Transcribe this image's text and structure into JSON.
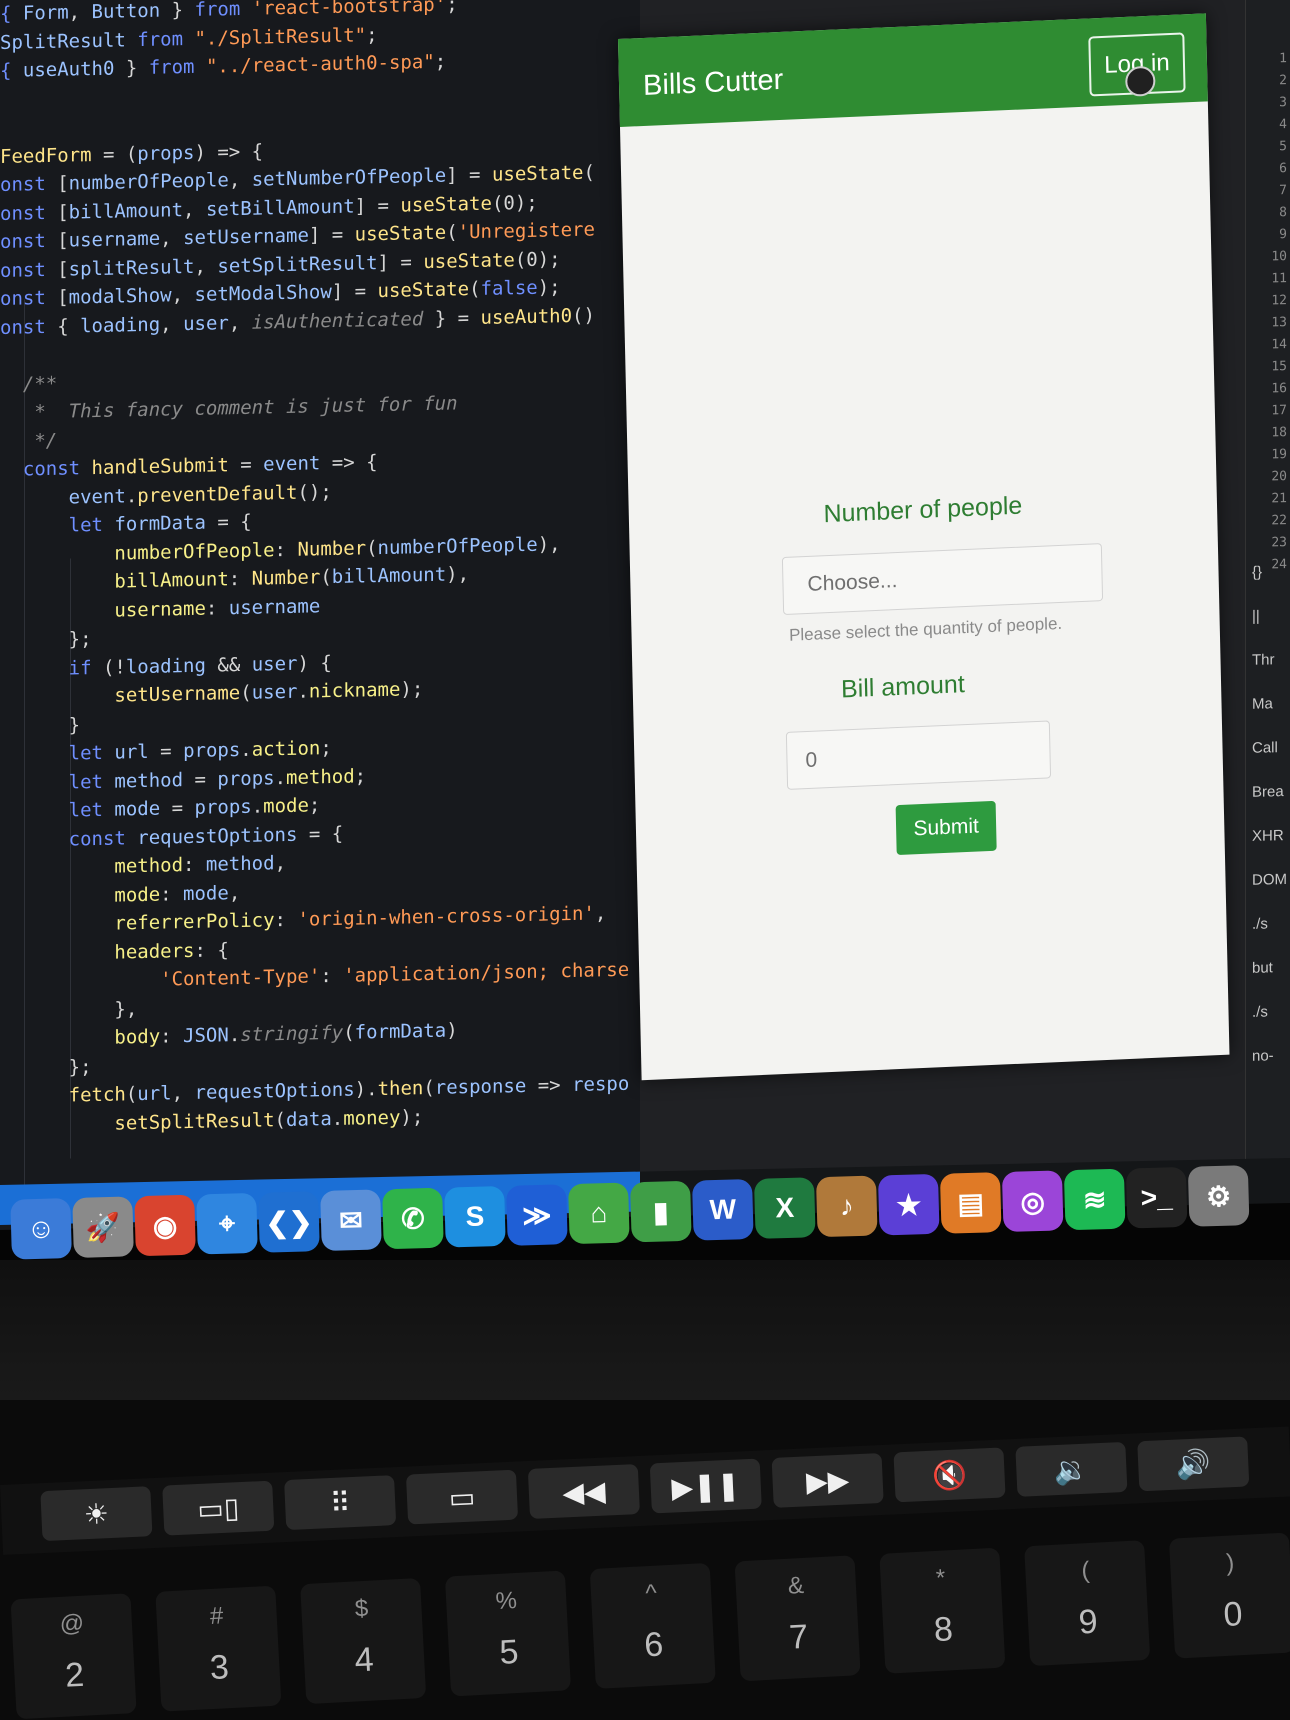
{
  "editor": {
    "lines": [
      [
        [
          "kw",
          "{ "
        ],
        [
          "var",
          "Form"
        ],
        [
          "",
          ","
        ],
        [
          "var",
          " Button"
        ],
        [
          "",
          " } "
        ],
        [
          "kw",
          "from "
        ],
        [
          "str",
          "'react-bootstrap'"
        ],
        [
          "",
          ";"
        ]
      ],
      [
        [
          "var",
          "SplitResult "
        ],
        [
          "kw",
          "from "
        ],
        [
          "str",
          "\"./SplitResult\""
        ],
        [
          "",
          ";"
        ]
      ],
      [
        [
          "",
          ""
        ],
        [
          "kw",
          "{ "
        ],
        [
          "var",
          "useAuth0"
        ],
        [
          "",
          " } "
        ],
        [
          "kw",
          "from "
        ],
        [
          "str",
          "\"../react-auth0-spa\""
        ],
        [
          "",
          ";"
        ]
      ],
      [
        [
          "",
          ""
        ]
      ],
      [
        [
          "",
          ""
        ]
      ],
      [
        [
          "fn",
          "FeedForm"
        ],
        [
          "",
          " = ("
        ],
        [
          "var",
          "props"
        ],
        [
          "",
          ") => {"
        ]
      ],
      [
        [
          "kw",
          "onst "
        ],
        [
          "",
          "["
        ],
        [
          "var",
          "numberOfPeople"
        ],
        [
          "",
          ", "
        ],
        [
          "var",
          "setNumberOfPeople"
        ],
        [
          "",
          "] = "
        ],
        [
          "fn",
          "useState"
        ],
        [
          "",
          "("
        ]
      ],
      [
        [
          "kw",
          "onst "
        ],
        [
          "",
          "["
        ],
        [
          "var",
          "billAmount"
        ],
        [
          "",
          ", "
        ],
        [
          "var",
          "setBillAmount"
        ],
        [
          "",
          "] = "
        ],
        [
          "fn",
          "useState"
        ],
        [
          "",
          "(0);"
        ]
      ],
      [
        [
          "kw",
          "onst "
        ],
        [
          "",
          "["
        ],
        [
          "var",
          "username"
        ],
        [
          "",
          ", "
        ],
        [
          "var",
          "setUsername"
        ],
        [
          "",
          "] = "
        ],
        [
          "fn",
          "useState"
        ],
        [
          "",
          "("
        ],
        [
          "str",
          "'Unregistere"
        ]
      ],
      [
        [
          "kw",
          "onst "
        ],
        [
          "",
          "["
        ],
        [
          "var",
          "splitResult"
        ],
        [
          "",
          ", "
        ],
        [
          "var",
          "setSplitResult"
        ],
        [
          "",
          "] = "
        ],
        [
          "fn",
          "useState"
        ],
        [
          "",
          "(0);"
        ]
      ],
      [
        [
          "kw",
          "onst "
        ],
        [
          "",
          "["
        ],
        [
          "var",
          "modalShow"
        ],
        [
          "",
          ", "
        ],
        [
          "var",
          "setModalShow"
        ],
        [
          "",
          "] = "
        ],
        [
          "fn",
          "useState"
        ],
        [
          "",
          "("
        ],
        [
          "kw",
          "false"
        ],
        [
          "",
          ");"
        ]
      ],
      [
        [
          "kw",
          "onst "
        ],
        [
          "",
          "{ "
        ],
        [
          "var",
          "loading"
        ],
        [
          "",
          ", "
        ],
        [
          "var",
          "user"
        ],
        [
          "",
          ", "
        ],
        [
          "cmt",
          "isAuthenticated"
        ],
        [
          "",
          " } = "
        ],
        [
          "fn",
          "useAuth0"
        ],
        [
          "",
          "()"
        ]
      ],
      [
        [
          "",
          ""
        ]
      ],
      [
        [
          "cmt",
          "  /**"
        ]
      ],
      [
        [
          "cmt",
          "   *  This fancy comment is just for fun"
        ]
      ],
      [
        [
          "cmt",
          "   */"
        ]
      ],
      [
        [
          "kw",
          "  const "
        ],
        [
          "fn",
          "handleSubmit"
        ],
        [
          "",
          " = "
        ],
        [
          "var",
          "event"
        ],
        [
          "",
          " => {"
        ]
      ],
      [
        [
          "",
          "      "
        ],
        [
          "var",
          "event"
        ],
        [
          "",
          "."
        ],
        [
          "fn",
          "preventDefault"
        ],
        [
          "",
          "();"
        ]
      ],
      [
        [
          "",
          "      "
        ],
        [
          "kw",
          "let "
        ],
        [
          "var",
          "formData"
        ],
        [
          "",
          " = {"
        ]
      ],
      [
        [
          "",
          "          "
        ],
        [
          "ent",
          "numberOfPeople"
        ],
        [
          "",
          ": "
        ],
        [
          "fn",
          "Number"
        ],
        [
          "",
          "("
        ],
        [
          "var",
          "numberOfPeople"
        ],
        [
          "",
          "),"
        ]
      ],
      [
        [
          "",
          "          "
        ],
        [
          "ent",
          "billAmount"
        ],
        [
          "",
          ": "
        ],
        [
          "fn",
          "Number"
        ],
        [
          "",
          "("
        ],
        [
          "var",
          "billAmount"
        ],
        [
          "",
          "),"
        ]
      ],
      [
        [
          "",
          "          "
        ],
        [
          "ent",
          "username"
        ],
        [
          "",
          ": "
        ],
        [
          "var",
          "username"
        ]
      ],
      [
        [
          "",
          "      };"
        ]
      ],
      [
        [
          "",
          "      "
        ],
        [
          "kw",
          "if "
        ],
        [
          "",
          "(!"
        ],
        [
          "var",
          "loading"
        ],
        [
          "",
          " && "
        ],
        [
          "var",
          "user"
        ],
        [
          "",
          ") {"
        ]
      ],
      [
        [
          "",
          "          "
        ],
        [
          "fn",
          "setUsername"
        ],
        [
          "",
          "("
        ],
        [
          "var",
          "user"
        ],
        [
          "",
          "."
        ],
        [
          "ent",
          "nickname"
        ],
        [
          "",
          ");"
        ]
      ],
      [
        [
          "",
          "      }"
        ]
      ],
      [
        [
          "",
          "      "
        ],
        [
          "kw",
          "let "
        ],
        [
          "var",
          "url"
        ],
        [
          "",
          " = "
        ],
        [
          "var",
          "props"
        ],
        [
          "",
          "."
        ],
        [
          "ent",
          "action"
        ],
        [
          "",
          ";"
        ]
      ],
      [
        [
          "",
          "      "
        ],
        [
          "kw",
          "let "
        ],
        [
          "var",
          "method"
        ],
        [
          "",
          " = "
        ],
        [
          "var",
          "props"
        ],
        [
          "",
          "."
        ],
        [
          "ent",
          "method"
        ],
        [
          "",
          ";"
        ]
      ],
      [
        [
          "",
          "      "
        ],
        [
          "kw",
          "let "
        ],
        [
          "var",
          "mode"
        ],
        [
          "",
          " = "
        ],
        [
          "var",
          "props"
        ],
        [
          "",
          "."
        ],
        [
          "ent",
          "mode"
        ],
        [
          "",
          ";"
        ]
      ],
      [
        [
          "",
          "      "
        ],
        [
          "kw",
          "const "
        ],
        [
          "var",
          "requestOptions"
        ],
        [
          "",
          " = {"
        ]
      ],
      [
        [
          "",
          "          "
        ],
        [
          "ent",
          "method"
        ],
        [
          "",
          ": "
        ],
        [
          "var",
          "method"
        ],
        [
          "",
          ","
        ]
      ],
      [
        [
          "",
          "          "
        ],
        [
          "ent",
          "mode"
        ],
        [
          "",
          ": "
        ],
        [
          "var",
          "mode"
        ],
        [
          "",
          ","
        ]
      ],
      [
        [
          "",
          "          "
        ],
        [
          "ent",
          "referrerPolicy"
        ],
        [
          "",
          ": "
        ],
        [
          "str",
          "'origin-when-cross-origin'"
        ],
        [
          "",
          ","
        ]
      ],
      [
        [
          "",
          "          "
        ],
        [
          "ent",
          "headers"
        ],
        [
          "",
          ": {"
        ]
      ],
      [
        [
          "",
          "              "
        ],
        [
          "str",
          "'Content-Type'"
        ],
        [
          "",
          ": "
        ],
        [
          "str",
          "'application/json; charse"
        ]
      ],
      [
        [
          "",
          "          },"
        ]
      ],
      [
        [
          "",
          "          "
        ],
        [
          "ent",
          "body"
        ],
        [
          "",
          ": "
        ],
        [
          "var",
          "JSON"
        ],
        [
          "",
          "."
        ],
        [
          "cmt",
          "stringify"
        ],
        [
          "",
          "("
        ],
        [
          "var",
          "formData"
        ],
        [
          "",
          ")"
        ]
      ],
      [
        [
          "",
          "      };"
        ]
      ],
      [
        [
          "",
          "      "
        ],
        [
          "fn",
          "fetch"
        ],
        [
          "",
          "("
        ],
        [
          "var",
          "url"
        ],
        [
          "",
          ", "
        ],
        [
          "var",
          "requestOptions"
        ],
        [
          "",
          ")."
        ],
        [
          "fn",
          "then"
        ],
        [
          "",
          "("
        ],
        [
          "var",
          "response"
        ],
        [
          "",
          " => "
        ],
        [
          "var",
          "respo"
        ]
      ],
      [
        [
          "",
          "          "
        ],
        [
          "fn",
          "setSplitResult"
        ],
        [
          "",
          "("
        ],
        [
          "var",
          "data"
        ],
        [
          "",
          "."
        ],
        [
          "ent",
          "money"
        ],
        [
          "",
          ");"
        ]
      ]
    ]
  },
  "app": {
    "brand": "Bills Cutter",
    "login_label": "Log in",
    "form": {
      "people_label": "Number of people",
      "people_placeholder": "Choose...",
      "people_help": "Please select the quantity of people.",
      "bill_label": "Bill amount",
      "bill_value": "0",
      "submit_label": "Submit"
    }
  },
  "devtools": {
    "line_numbers": [
      "1",
      "2",
      "3",
      "4",
      "5",
      "6",
      "7",
      "8",
      "9",
      "10",
      "11",
      "12",
      "13",
      "14",
      "15",
      "16",
      "17",
      "18",
      "19",
      "20",
      "21",
      "22",
      "23",
      "24"
    ],
    "items": [
      "{}",
      "||",
      "Thr",
      "Ma",
      "Call",
      "Brea",
      "XHR",
      "DOM",
      "./s",
      "but",
      "./s",
      "no-"
    ]
  },
  "dock": {
    "icons": [
      {
        "name": "finder-icon",
        "glyph": "☺",
        "color": "#3b7bd8"
      },
      {
        "name": "launchpad-icon",
        "glyph": "🚀",
        "color": "#8a8a8a"
      },
      {
        "name": "chrome-icon",
        "glyph": "◉",
        "color": "#d9442f"
      },
      {
        "name": "safari-icon",
        "glyph": "⌖",
        "color": "#2f86e0"
      },
      {
        "name": "vscode-icon",
        "glyph": "❮❯",
        "color": "#1f6fd1"
      },
      {
        "name": "preview-icon",
        "glyph": "✉",
        "color": "#5a8fd8"
      },
      {
        "name": "whatsapp-icon",
        "glyph": "✆",
        "color": "#2fb34a"
      },
      {
        "name": "skype-icon",
        "glyph": "S",
        "color": "#1e8fe0"
      },
      {
        "name": "jira-icon",
        "glyph": "≫",
        "color": "#1f5fd6"
      },
      {
        "name": "maps-icon",
        "glyph": "⌂",
        "color": "#44a845"
      },
      {
        "name": "numbers-icon",
        "glyph": "▮",
        "color": "#3f9e47"
      },
      {
        "name": "word-icon",
        "glyph": "W",
        "color": "#2b5cc9"
      },
      {
        "name": "excel-icon",
        "glyph": "X",
        "color": "#1f7a3f"
      },
      {
        "name": "instruments-icon",
        "glyph": "♪",
        "color": "#b0793a"
      },
      {
        "name": "imovie-icon",
        "glyph": "★",
        "color": "#5b3fd6"
      },
      {
        "name": "books-icon",
        "glyph": "▤",
        "color": "#e07a26"
      },
      {
        "name": "podcasts-icon",
        "glyph": "◎",
        "color": "#9b45d8"
      },
      {
        "name": "spotify-icon",
        "glyph": "≋",
        "color": "#1db954"
      },
      {
        "name": "terminal-icon",
        "glyph": ">_",
        "color": "#222222"
      },
      {
        "name": "system-preferences-icon",
        "glyph": "⚙",
        "color": "#7a7a7a"
      }
    ]
  },
  "touchbar": {
    "buttons": [
      {
        "name": "brightness-icon",
        "glyph": "☀"
      },
      {
        "name": "mission-control-icon",
        "glyph": "▭▯"
      },
      {
        "name": "launchpad-grid-icon",
        "glyph": "⠿"
      },
      {
        "name": "display-icon",
        "glyph": "▭"
      },
      {
        "name": "rewind-icon",
        "glyph": "◀◀"
      },
      {
        "name": "play-pause-icon",
        "glyph": "▶❚❚"
      },
      {
        "name": "fast-forward-icon",
        "glyph": "▶▶"
      },
      {
        "name": "mute-icon",
        "glyph": "🔇"
      },
      {
        "name": "volume-down-icon",
        "glyph": "🔉"
      },
      {
        "name": "volume-up-icon",
        "glyph": "🔊"
      }
    ]
  },
  "keys": [
    {
      "top": "@",
      "bot": "2"
    },
    {
      "top": "#",
      "bot": "3"
    },
    {
      "top": "$",
      "bot": "4"
    },
    {
      "top": "%",
      "bot": "5"
    },
    {
      "top": "^",
      "bot": "6"
    },
    {
      "top": "&",
      "bot": "7"
    },
    {
      "top": "*",
      "bot": "8"
    },
    {
      "top": "(",
      "bot": "9"
    },
    {
      "top": ")",
      "bot": "0"
    }
  ]
}
